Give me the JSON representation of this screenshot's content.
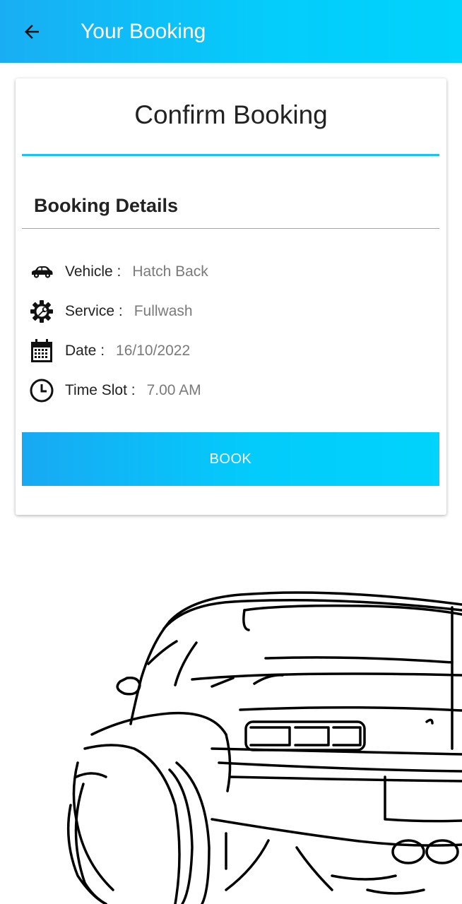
{
  "appbar": {
    "title": "Your Booking",
    "back_icon": "arrow-left-icon",
    "gradient": [
      "#19aef3",
      "#00d3fc"
    ]
  },
  "card": {
    "title": "Confirm Booking",
    "section_title": "Booking Details",
    "details": [
      {
        "icon": "car-icon",
        "label": "Vehicle :",
        "value": "Hatch Back"
      },
      {
        "icon": "gear-wrench-icon",
        "label": "Service :",
        "value": "Fullwash"
      },
      {
        "icon": "calendar-icon",
        "label": "Date :",
        "value": "16/10/2022"
      },
      {
        "icon": "clock-icon",
        "label": "Time Slot :",
        "value": "7.00 AM"
      }
    ],
    "book_label": "BOOK"
  },
  "colors": {
    "accent": "#16c4f6",
    "button": "#03cbfb"
  }
}
